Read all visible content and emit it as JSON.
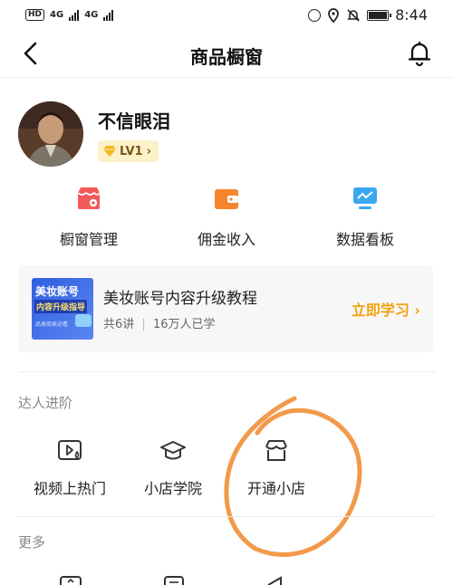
{
  "status_bar": {
    "network_badge": "HD",
    "signal_1": "4G",
    "signal_2": "4G",
    "time": "8:44"
  },
  "nav": {
    "title": "商品橱窗",
    "back_icon": "chevron-left",
    "bell_icon": "bell"
  },
  "profile": {
    "name": "不信眼泪",
    "level": "LV1",
    "level_arrow": "›"
  },
  "tools": [
    {
      "label": "橱窗管理",
      "icon": "shop-settings",
      "color": "#f25a5a"
    },
    {
      "label": "佣金收入",
      "icon": "wallet",
      "color": "#f5862e"
    },
    {
      "label": "数据看板",
      "icon": "monitor-chart",
      "color": "#3aa7f0"
    }
  ],
  "course": {
    "thumb_line1": "美妆账号",
    "thumb_line2": "内容升级指导",
    "thumb_line3": "品类商家必看",
    "title": "美妆账号内容升级教程",
    "lessons": "共6讲",
    "learners": "16万人已学",
    "cta": "立即学习"
  },
  "advanced": {
    "label": "达人进阶",
    "items": [
      {
        "label": "视频上热门",
        "icon": "video-hot"
      },
      {
        "label": "小店学院",
        "icon": "graduation-cap"
      },
      {
        "label": "开通小店",
        "icon": "store"
      }
    ]
  },
  "more": {
    "label": "更多"
  },
  "colors": {
    "accent": "#f3a20c",
    "annotation": "#f29a4a",
    "level_bg": "#fdf1c9"
  }
}
